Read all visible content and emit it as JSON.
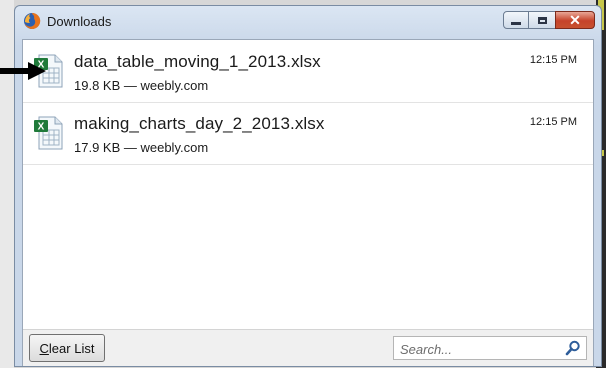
{
  "window": {
    "title": "Downloads"
  },
  "downloads": [
    {
      "filename": "data_table_moving_1_2013.xlsx",
      "meta": "19.8 KB — weebly.com",
      "time": "12:15 PM",
      "icon": "excel-file-icon"
    },
    {
      "filename": "making_charts_day_2_2013.xlsx",
      "meta": "17.9 KB — weebly.com",
      "time": "12:15 PM",
      "icon": "excel-file-icon"
    }
  ],
  "footer": {
    "clear_first_letter": "C",
    "clear_rest": "lear List",
    "search_placeholder": "Search..."
  },
  "colors": {
    "close_button": "#c6432a",
    "excel_green": "#1f7a3a"
  }
}
